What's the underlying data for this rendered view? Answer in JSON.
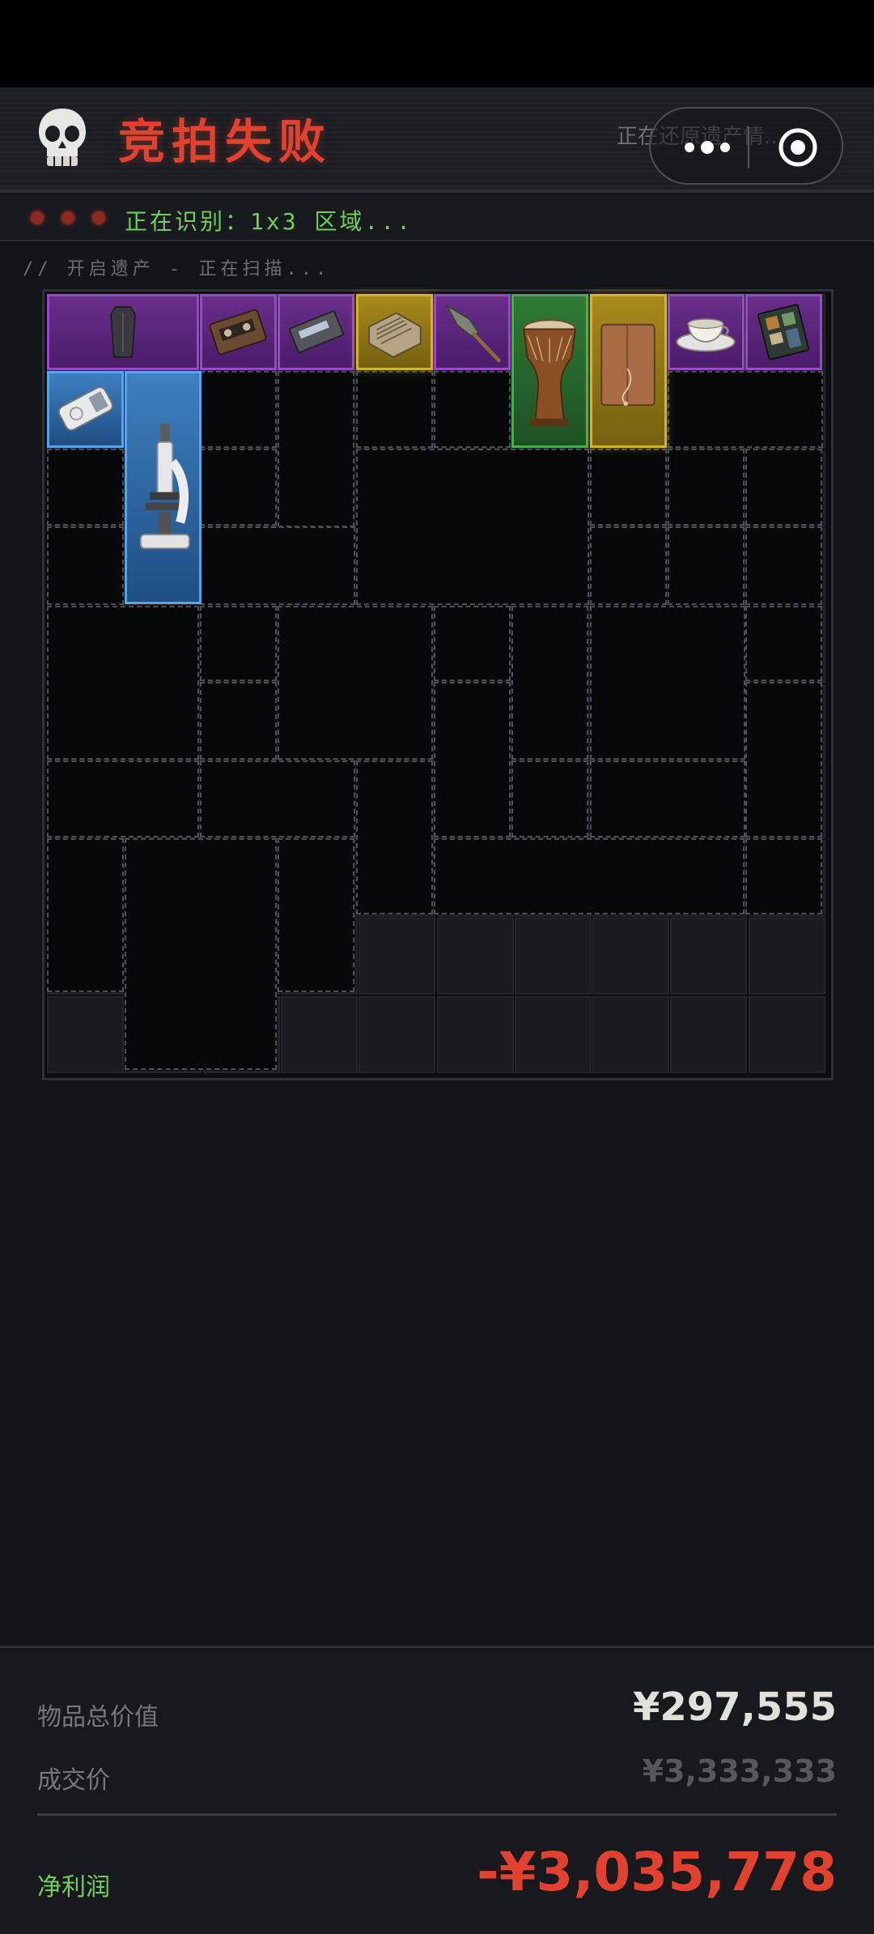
{
  "header": {
    "title": "竞拍失败",
    "subtitle": "正在还原遗产情..."
  },
  "scan": {
    "status": "正在识别：1x3 区域..."
  },
  "open_label": "// 开启遗产 - 正在扫描...",
  "colors": {
    "title_red": "#e2412f",
    "scan_green": "#6fcf5a",
    "profit_red": "#e2412f",
    "rarity_purple": "#9b45cf",
    "rarity_gold": "#d4b32a",
    "rarity_green": "#4aaa52",
    "rarity_blue": "#5aa3e6"
  },
  "items": [
    {
      "icon": "coffin-icon",
      "rarity": "purple"
    },
    {
      "icon": "cassette-tape-icon",
      "rarity": "purple"
    },
    {
      "icon": "memory-module-icon",
      "rarity": "purple"
    },
    {
      "icon": "vintage-radio-icon",
      "rarity": "gold"
    },
    {
      "icon": "spear-head-icon",
      "rarity": "purple"
    },
    {
      "icon": "djembe-drum-icon",
      "rarity": "green"
    },
    {
      "icon": "leather-journal-icon",
      "rarity": "gold"
    },
    {
      "icon": "teacup-icon",
      "rarity": "purple"
    },
    {
      "icon": "circuit-board-icon",
      "rarity": "purple"
    },
    {
      "icon": "mp3-player-icon",
      "rarity": "blue"
    },
    {
      "icon": "microscope-icon",
      "rarity": "blue"
    }
  ],
  "summary": {
    "total_value_label": "物品总价值",
    "total_value": "¥297,555",
    "deal_price_label": "成交价",
    "deal_price": "¥3,333,333",
    "net_profit_label": "净利润",
    "net_profit": "-¥3,035,778"
  }
}
